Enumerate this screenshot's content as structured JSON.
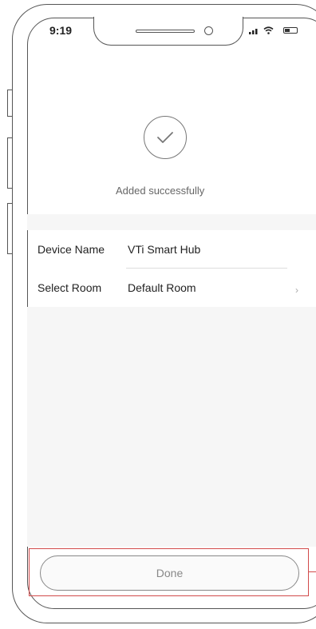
{
  "status_bar": {
    "time": "9:19",
    "signal_icon": "signal-bars-icon",
    "wifi_icon": "wifi-icon",
    "battery_icon": "battery-icon"
  },
  "result": {
    "icon": "check-circle-icon",
    "message": "Added successfully"
  },
  "device_form": {
    "rows": [
      {
        "label": "Device Name",
        "value": "VTi Smart Hub"
      },
      {
        "label": "Select Room",
        "value": "Default Room"
      }
    ]
  },
  "footer": {
    "done_label": "Done"
  },
  "colors": {
    "highlight": "#d24b4b",
    "frame": "#555555",
    "muted_text": "#888888"
  }
}
